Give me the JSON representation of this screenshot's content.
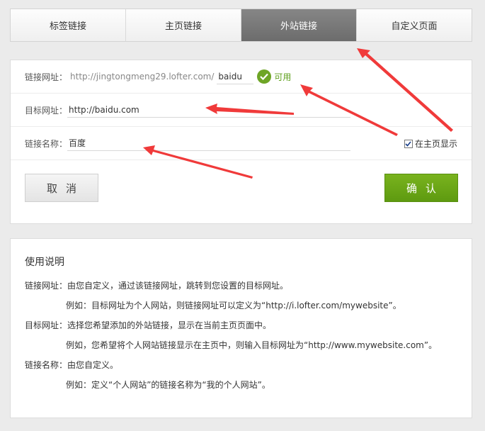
{
  "tabs": [
    {
      "label": "标签链接",
      "active": false
    },
    {
      "label": "主页链接",
      "active": false
    },
    {
      "label": "外站链接",
      "active": true
    },
    {
      "label": "自定义页面",
      "active": false
    }
  ],
  "form": {
    "link_url": {
      "label": "链接网址：",
      "prefix": "http://jingtongmeng29.lofter.com/",
      "value": "baidu",
      "status": "可用"
    },
    "target_url": {
      "label": "目标网址：",
      "value": "http://baidu.com"
    },
    "link_name": {
      "label": "链接名称：",
      "value": "百度"
    },
    "show_home": {
      "label": "在主页显示",
      "checked": true
    },
    "cancel_label": "取消",
    "ok_label": "确认"
  },
  "help": {
    "title": "使用说明",
    "lines": [
      "链接网址：由您自定义，通过该链接网址，跳转到您设置的目标网址。",
      "例如：目标网址为个人网站，则链接网址可以定义为“http://i.lofter.com/mywebsite”。",
      "目标网址：选择您希望添加的外站链接，显示在当前主页页面中。",
      "例如，您希望将个人网站链接显示在主页中，则输入目标网址为“http://www.mywebsite.com”。",
      "链接名称：由您自定义。",
      "例如：定义“个人网站”的链接名称为“我的个人网站”。"
    ]
  },
  "colors": {
    "accent_green": "#6ea526",
    "arrow_red": "#f03a3a",
    "active_tab": "#777777"
  }
}
